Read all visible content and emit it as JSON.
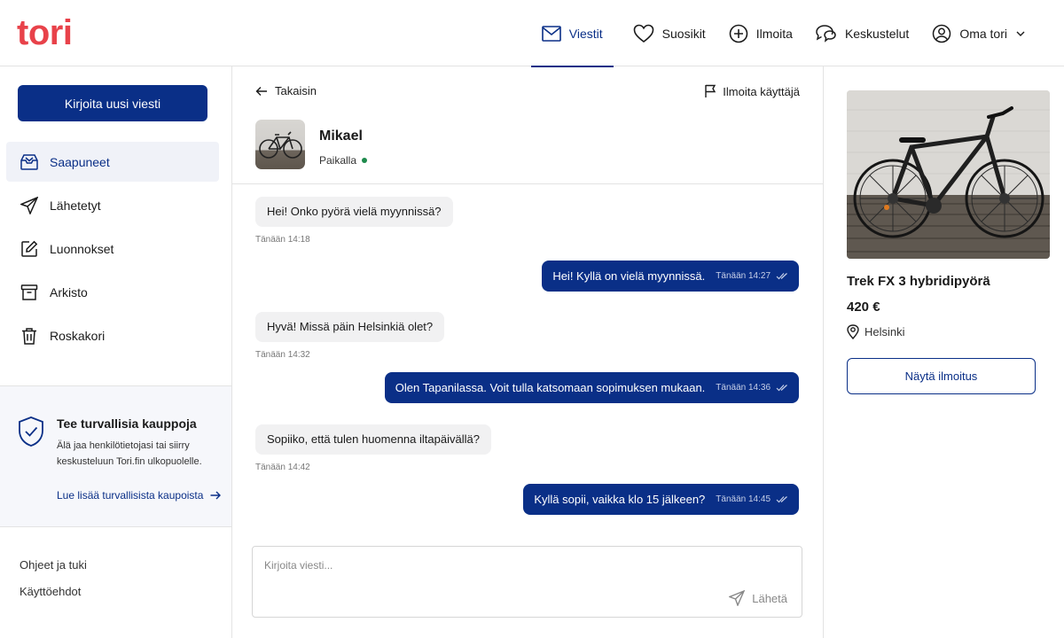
{
  "brand": {
    "logo": "tori",
    "color": "#e8424a",
    "accent": "#0a2f87"
  },
  "nav": {
    "messages": "Viestit",
    "favorites": "Suosikit",
    "post": "Ilmoita",
    "discussions": "Keskustelut",
    "account": "Oma tori"
  },
  "sidebar": {
    "new_message": "Kirjoita uusi viesti",
    "items": [
      {
        "label": "Saapuneet",
        "icon": "inbox-icon"
      },
      {
        "label": "Lähetetyt",
        "icon": "send-icon"
      },
      {
        "label": "Luonnokset",
        "icon": "edit-icon"
      },
      {
        "label": "Arkisto",
        "icon": "archive-icon"
      },
      {
        "label": "Roskakori",
        "icon": "trash-icon"
      }
    ],
    "safety": {
      "title": "Tee turvallisia kauppoja",
      "text": "Älä jaa henkilötietojasi tai siirry keskusteluun Tori.fin ulkopuolelle.",
      "link": "Lue lisää turvallisista kaupoista"
    },
    "footer": [
      "Ohjeet ja tuki",
      "Käyttöehdot"
    ]
  },
  "conversation": {
    "back": "Takaisin",
    "report": "Ilmoita käyttäjä",
    "contact_name": "Mikael",
    "contact_status": "Paikalla",
    "messages": [
      {
        "from": "them",
        "text": "Hei! Onko pyörä vielä myynnissä?",
        "time": "Tänään 14:18"
      },
      {
        "from": "me",
        "text": "Hei! Kyllä on vielä myynnissä.",
        "time": "Tänään 14:27"
      },
      {
        "from": "them",
        "text": "Hyvä! Missä päin Helsinkiä olet?",
        "time": "Tänään 14:32"
      },
      {
        "from": "me",
        "text": "Olen Tapanilassa. Voit tulla katsomaan sopimuksen mukaan.",
        "time": "Tänään 14:36"
      },
      {
        "from": "them",
        "text": "Sopiiko, että tulen huomenna iltapäivällä?",
        "time": "Tänään 14:42"
      },
      {
        "from": "me",
        "text": "Kyllä sopii, vaikka klo 15 jälkeen?",
        "time": "Tänään 14:45"
      }
    ],
    "compose_placeholder": "Kirjoita viesti...",
    "send": "Lähetä"
  },
  "listing": {
    "title": "Trek FX 3 hybridipyörä",
    "price": "420 €",
    "location": "Helsinki",
    "button": "Näytä ilmoitus"
  }
}
